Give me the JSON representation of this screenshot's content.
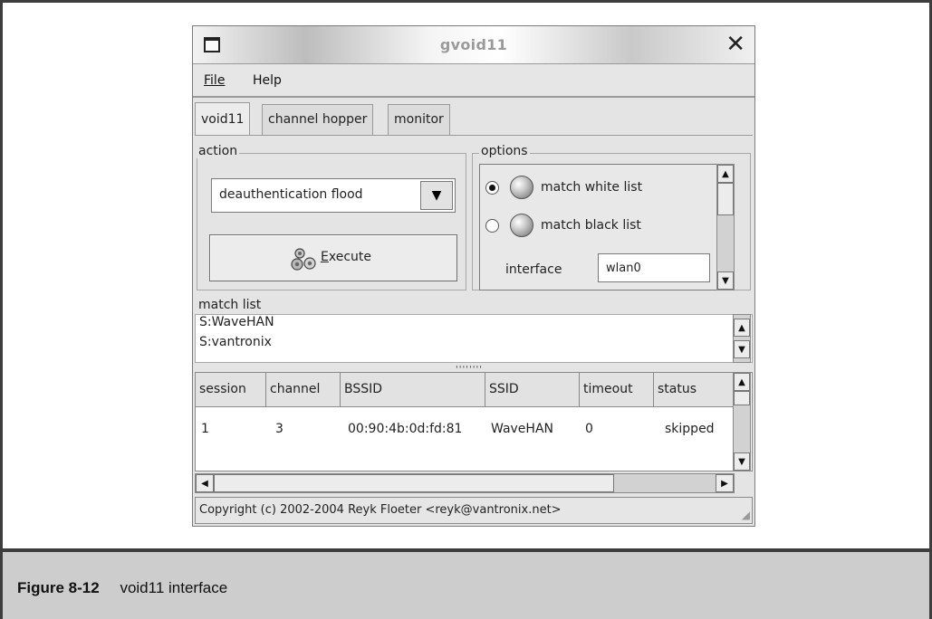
{
  "window": {
    "title": "gvoid11",
    "close_glyph": "✕"
  },
  "menubar": {
    "file": "File",
    "help": "Help"
  },
  "tabs": [
    {
      "label": "void11"
    },
    {
      "label": "channel hopper"
    },
    {
      "label": "monitor"
    }
  ],
  "action": {
    "group_label": "action",
    "selected": "deauthentication flood",
    "execute_label": "Execute"
  },
  "options": {
    "group_label": "options",
    "radio_white": "match white list",
    "radio_black": "match black list",
    "selected": "match white list",
    "interface_label": "interface",
    "interface_value": "wlan0"
  },
  "match_list": {
    "label": "match list",
    "items": [
      "S:WaveHAN",
      "S:vantronix"
    ]
  },
  "table": {
    "headers": [
      "session",
      "channel",
      "BSSID",
      "SSID",
      "timeout",
      "status"
    ],
    "rows": [
      [
        "1",
        "3",
        "00:90:4b:0d:fd:81",
        "WaveHAN",
        "0",
        "skipped"
      ]
    ]
  },
  "statusbar": {
    "text": "Copyright (c) 2002-2004 Reyk Floeter <reyk@vantronix.net>"
  },
  "caption": {
    "number": "Figure 8-12",
    "text": "void11 interface"
  }
}
